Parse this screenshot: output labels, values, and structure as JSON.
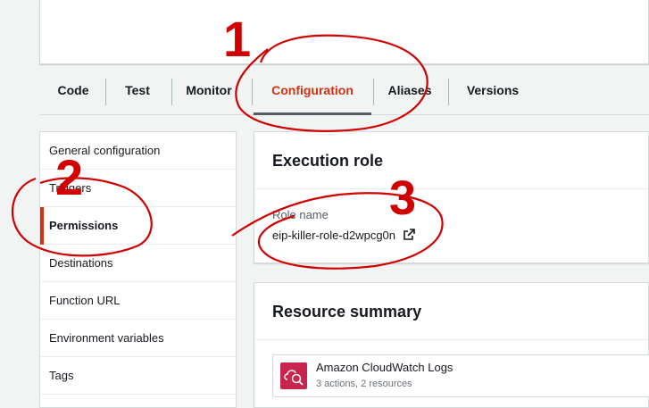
{
  "tabs": [
    {
      "label": "Code"
    },
    {
      "label": "Test"
    },
    {
      "label": "Monitor"
    },
    {
      "label": "Configuration",
      "active": true
    },
    {
      "label": "Aliases"
    },
    {
      "label": "Versions"
    }
  ],
  "side_nav": {
    "items": [
      {
        "label": "General configuration"
      },
      {
        "label": "Triggers"
      },
      {
        "label": "Permissions",
        "active": true
      },
      {
        "label": "Destinations"
      },
      {
        "label": "Function URL"
      },
      {
        "label": "Environment variables"
      },
      {
        "label": "Tags"
      }
    ]
  },
  "execution_role": {
    "title": "Execution role",
    "role_label": "Role name",
    "role_value": "eip-killer-role-d2wpcg0n"
  },
  "resource_summary": {
    "title": "Resource summary",
    "resource": {
      "name": "Amazon CloudWatch Logs",
      "detail": "3 actions, 2 resources",
      "icon": "cloudwatch-logs-icon"
    }
  },
  "annotations": {
    "numbers": [
      "1",
      "2",
      "3"
    ],
    "color": "#d10000"
  },
  "colors": {
    "accent": "#d13212",
    "background": "#f2f3f3"
  }
}
